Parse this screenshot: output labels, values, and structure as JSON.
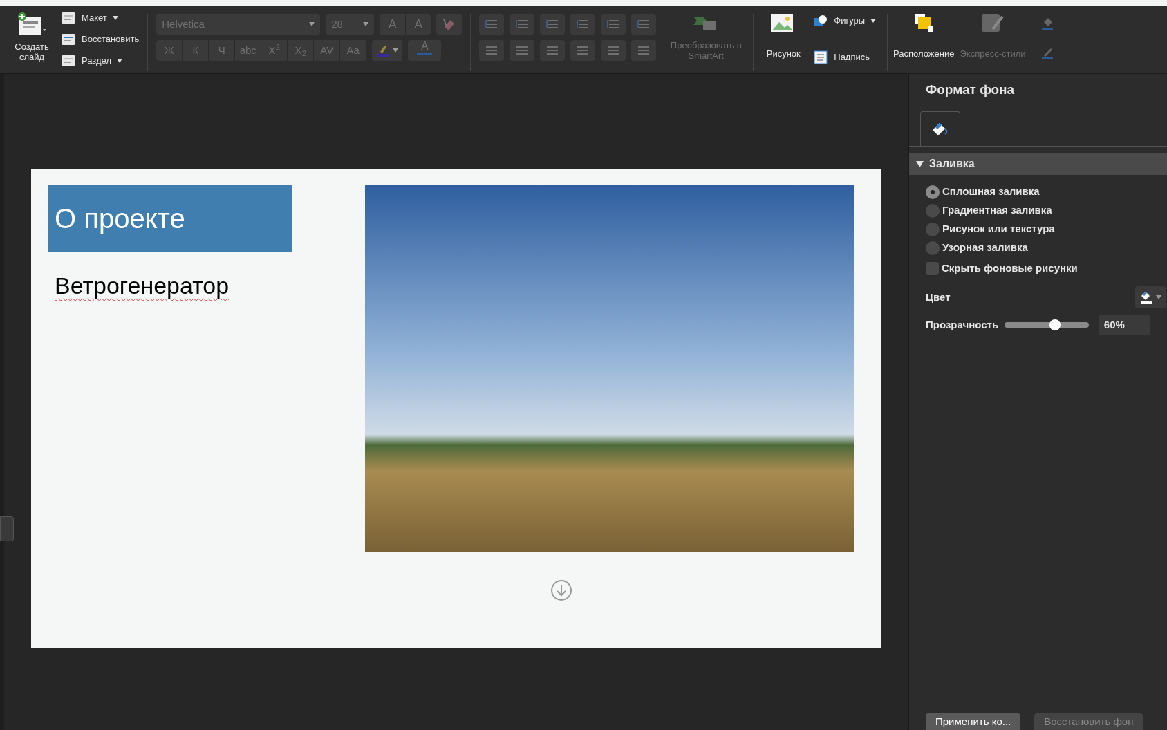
{
  "ribbon": {
    "new_slide": {
      "label": "Создать слайд"
    },
    "slide_commands": [
      {
        "label": "Макет",
        "dropdown": true
      },
      {
        "label": "Восстановить",
        "dropdown": false
      },
      {
        "label": "Раздел",
        "dropdown": true
      }
    ],
    "font": {
      "value": "Helvetica",
      "disabled": true
    },
    "font_size": {
      "value": "28",
      "disabled": true
    },
    "size_buttons": [
      {
        "label": "A",
        "disabled": true
      },
      {
        "label": "A",
        "disabled": true
      }
    ],
    "format_buttons": [
      {
        "label": "Ж",
        "disabled": true
      },
      {
        "label": "К",
        "disabled": true
      },
      {
        "label": "Ч",
        "disabled": true
      },
      {
        "label": "abc",
        "disabled": true
      },
      {
        "label": "X$^{2}$",
        "disabled": true
      },
      {
        "label": "X$_{2}$",
        "disabled": true
      },
      {
        "label": "AV",
        "disabled": true
      },
      {
        "label": "Aa",
        "disabled": true
      }
    ],
    "font_color": {
      "label": "A",
      "disabled": true
    },
    "smartart": {
      "label": "Преобразовать в SmartArt",
      "disabled": true
    },
    "picture": {
      "label": "Рисунок"
    },
    "shapes": {
      "label": "Фигуры"
    },
    "textbox": {
      "label": "Надпись"
    },
    "arrange": {
      "label": "Расположение",
      "disabled": false
    },
    "quick_styles": {
      "label": "Экспресс-стили",
      "disabled": true
    }
  },
  "slide": {
    "title": "О проекте",
    "subtitle": "Ветрогенератор"
  },
  "panel": {
    "title": "Формат фона",
    "section": {
      "label": "Заливка",
      "expanded": true
    },
    "fill_options": [
      {
        "label": "Сплошная заливка",
        "selected": true
      },
      {
        "label": "Градиентная заливка",
        "selected": false
      },
      {
        "label": "Рисунок или текстура",
        "selected": false
      },
      {
        "label": "Узорная заливка",
        "selected": false
      }
    ],
    "hide_graphics": {
      "label": "Скрыть фоновые рисунки",
      "checked": false
    },
    "color": {
      "label": "Цвет"
    },
    "transparency": {
      "label": "Прозрачность",
      "level": 0.6,
      "reading": "60%"
    },
    "buttons": [
      {
        "label": "Применить ко...",
        "disabled": false
      },
      {
        "label": "Восстановить фон",
        "disabled": true
      }
    ]
  }
}
